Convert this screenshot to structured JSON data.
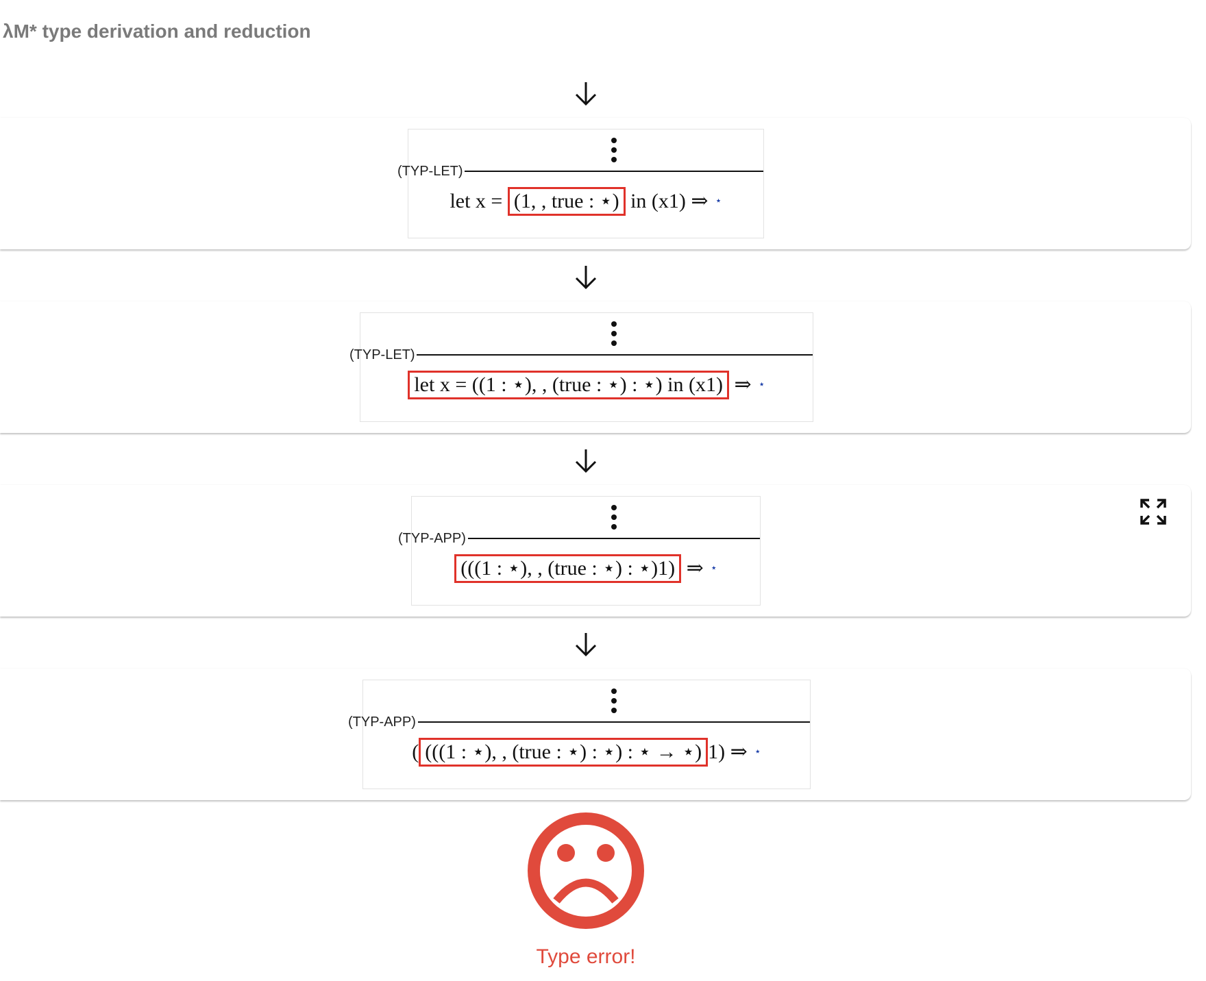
{
  "title": "λM* type derivation and reduction",
  "colors": {
    "highlight": "#e0322a",
    "error": "#e04a3c",
    "title": "#7a7a7a",
    "type_star": "#1a3ea8"
  },
  "icons": {
    "arrow": "arrow-down-icon",
    "ellipsis": "vertical-ellipsis-icon",
    "expand": "expand-icon",
    "error": "sad-face-icon"
  },
  "steps": [
    {
      "rule": "(TYP-LET)",
      "pre": "let x = ",
      "hl": "(1, , true : ⋆)",
      "post": " in (x1) ⇒",
      "type": "⋆"
    },
    {
      "rule": "(TYP-LET)",
      "pre": "",
      "hl": "let x = ((1 : ⋆), , (true : ⋆) : ⋆) in (x1)",
      "post": " ⇒",
      "type": "⋆"
    },
    {
      "rule": "(TYP-APP)",
      "pre": "",
      "hl": "(((1 : ⋆), , (true : ⋆) : ⋆)1)",
      "post": " ⇒",
      "type": "⋆"
    },
    {
      "rule": "(TYP-APP)",
      "pre": "(",
      "hl": "(((1 : ⋆), , (true : ⋆) : ⋆) : ⋆ → ⋆)",
      "post": "1) ⇒",
      "type": "⋆"
    }
  ],
  "error_text": "Type error!"
}
